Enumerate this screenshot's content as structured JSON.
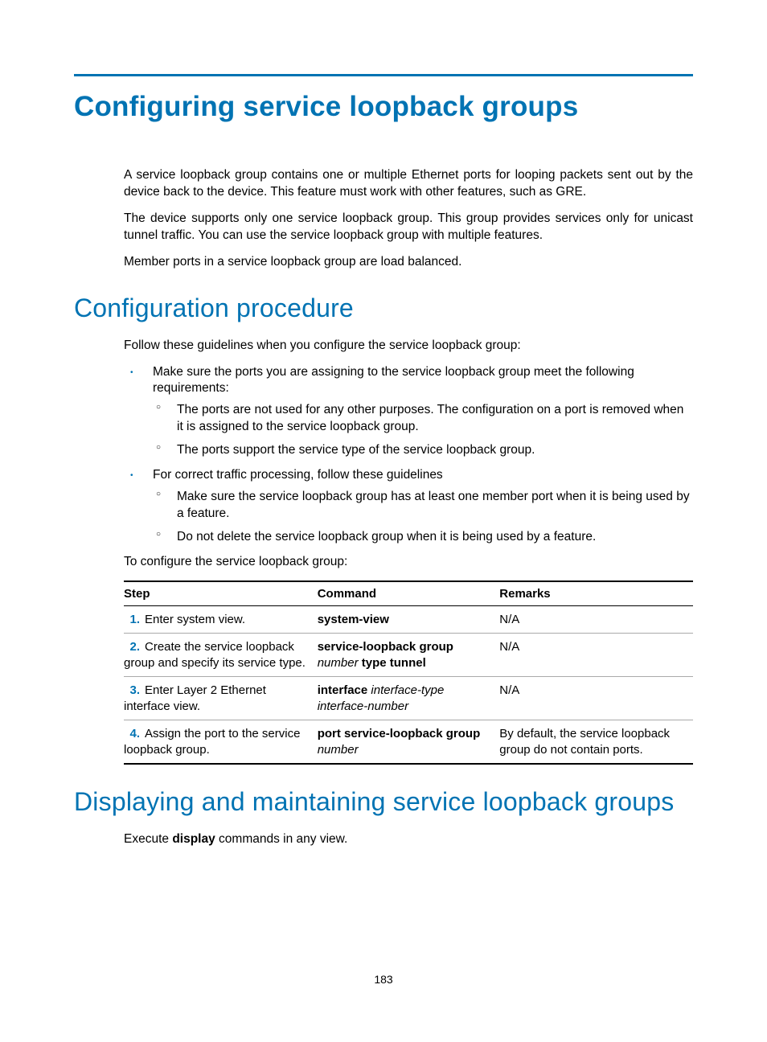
{
  "h1": "Configuring service loopback groups",
  "intro": {
    "p1": "A service loopback group contains one or multiple Ethernet ports for looping packets sent out by the device back to the device. This feature must work with other features, such as GRE.",
    "p2": "The device supports only one service loopback group. This group provides services only for unicast tunnel traffic. You can use the service loopback group with multiple features.",
    "p3": "Member ports in a service loopback group are load balanced."
  },
  "h2a": "Configuration procedure",
  "proc": {
    "lead": "Follow these guidelines when you configure the service loopback group:",
    "b1_lead": "Make sure the ports you are assigning to the service loopback group meet the following requirements:",
    "b1_s1": "The ports are not used for any other purposes. The configuration on a port is removed when it is assigned to the service loopback group.",
    "b1_s2": "The ports support the service type of the service loopback group.",
    "b2_lead": "For correct traffic processing, follow these guidelines",
    "b2_s1": "Make sure the service loopback group has at least one member port when it is being used by a feature.",
    "b2_s2": "Do not delete the service loopback group when it is being used by a feature.",
    "table_lead": "To configure the service loopback group:",
    "th_step": "Step",
    "th_cmd": "Command",
    "th_rem": "Remarks",
    "rows": [
      {
        "n": "1.",
        "step": "Enter system view.",
        "cmd_b": "system-view",
        "cmd_i": "",
        "cmd_b2": "",
        "rem": "N/A"
      },
      {
        "n": "2.",
        "step": "Create the service loopback group and specify its service type.",
        "cmd_b": "service-loopback group",
        "cmd_i": " number ",
        "cmd_b2": "type tunnel",
        "rem": "N/A"
      },
      {
        "n": "3.",
        "step": "Enter Layer 2 Ethernet interface view.",
        "cmd_b": "interface",
        "cmd_i": " interface-type interface-number",
        "cmd_b2": "",
        "rem": "N/A"
      },
      {
        "n": "4.",
        "step": "Assign the port to the service loopback group.",
        "cmd_b": "port service-loopback group",
        "cmd_i": " number",
        "cmd_b2": "",
        "rem": "By default, the service loopback group do not contain ports."
      }
    ]
  },
  "h2b": "Displaying and maintaining service loopback groups",
  "disp": {
    "p_pre": "Execute ",
    "p_b": "display",
    "p_post": " commands in any view."
  },
  "page_num": "183"
}
